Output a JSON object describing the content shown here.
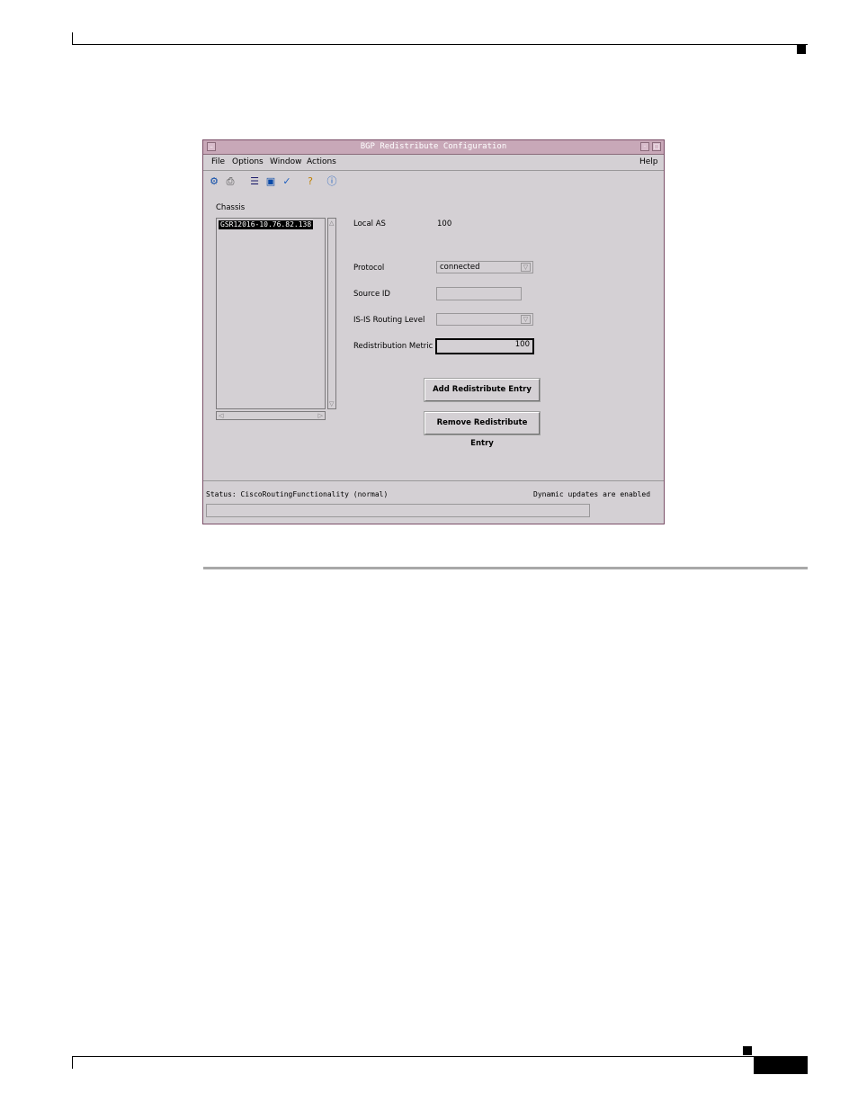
{
  "figure_id": "E90E9",
  "window": {
    "title": "BGP Redistribute Configuration",
    "menu": [
      "File",
      "Options",
      "Window",
      "Actions"
    ],
    "help": "Help",
    "toolbar_icons": [
      "run-icon",
      "print-icon",
      "list-icon",
      "monitor-icon",
      "check-icon",
      "help-icon",
      "info-icon"
    ]
  },
  "chassis": {
    "label": "Chassis",
    "items": [
      "GSR12016-10.76.82.138"
    ]
  },
  "form": {
    "local_as_label": "Local AS",
    "local_as_value": "100",
    "protocol_label": "Protocol",
    "protocol_value": "connected",
    "source_id_label": "Source ID",
    "source_id_value": "",
    "isis_label": "IS-IS Routing Level",
    "isis_value": "",
    "metric_label": "Redistribution Metric",
    "metric_value": "100"
  },
  "buttons": {
    "add": "Add Redistribute Entry",
    "remove": "Remove Redistribute Entry"
  },
  "status": {
    "left": "Status: CiscoRoutingFunctionality (normal)",
    "right": "Dynamic updates are enabled"
  }
}
